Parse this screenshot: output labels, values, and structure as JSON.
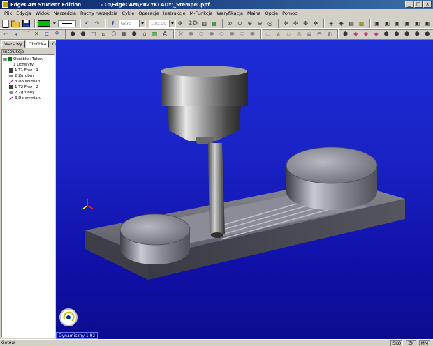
{
  "window": {
    "app_title": "EdgeCAM Student Edition",
    "file_path": "- C:\\EdgeCAM\\PRZYKLADY\\_Stempel.ppf"
  },
  "menu": [
    "Plik",
    "Edycja",
    "Widok",
    "Narzędzia",
    "Ruchy narzędzia",
    "Cykle",
    "Operacje",
    "Instrukcje",
    "M-Funkcje",
    "Weryfikacja",
    "Maina",
    "Opcje",
    "Pomoc"
  ],
  "toolbar": {
    "view_combo": "Góra",
    "value_combo": "100.00",
    "mode_2d": "2D",
    "info_button": "i"
  },
  "left_panel": {
    "tabs": [
      "Warstwy",
      "Obróbka",
      "Cechy"
    ],
    "active_tab": "Obróbka",
    "subtab": "Instrukcje",
    "tree": [
      {
        "label": "Obróbka: Tokar.",
        "indent": 0
      },
      {
        "label": "1 Uchwyty",
        "indent": 2
      },
      {
        "label": "1 T1 Frez : 1",
        "indent": 1
      },
      {
        "label": "2 Zgrubny",
        "indent": 1
      },
      {
        "label": "3 Do wymiaru",
        "indent": 1
      },
      {
        "label": "1 T2 Frez : 2",
        "indent": 1
      },
      {
        "label": "2 Zgrubny",
        "indent": 1
      },
      {
        "label": "3 Do wymiaru",
        "indent": 1
      }
    ]
  },
  "viewport": {
    "status_text": "Dynamiczny 1.92"
  },
  "statusbar": {
    "left": "Gotów",
    "right": [
      "SKO",
      "ZX",
      "MM"
    ]
  },
  "colors": {
    "title_start": "#0a246a",
    "viewport_blue": "#1c2cd8"
  }
}
